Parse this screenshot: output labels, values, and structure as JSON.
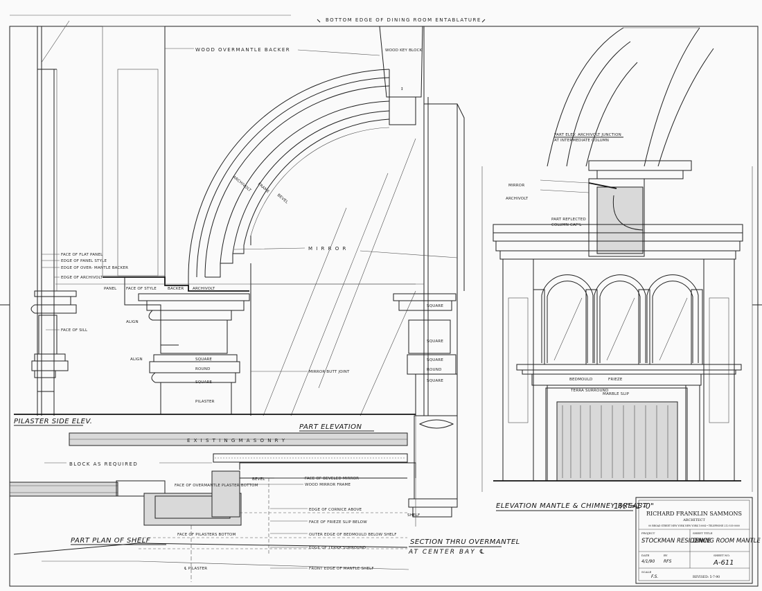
{
  "drawing": {
    "top_note": "BOTTOM EDGE OF DINING ROOM ENTABLATURE",
    "views": {
      "pilaster_side": "PILASTER SIDE ELEV.",
      "part_elevation": "PART ELEVATION",
      "part_plan": "PART PLAN OF SHELF",
      "section": "SECTION THRU OVERMANTEL",
      "section_sub": "AT CENTER BAY ℄",
      "elevation_mantle": "ELEVATION MANTLE & CHIMNEY BREAST",
      "elevation_scale": "1½\"=1'-0\"",
      "part_elev_archivolt": "PART ELEV. ARCHIVOLT JUNCTION",
      "part_elev_archivolt_sub": "AT INTERMEDIATE COLUMN",
      "part_reflected": "PART REFLECTED",
      "part_reflected_sub": "COLUMN CAP'L"
    },
    "labels": {
      "wood_overmantle_backer": "WOOD OVERMANTLE BACKER",
      "wood_key_block": "WOOD KEY BLOCK",
      "mirror": "M I R R O R",
      "archivolt": "ARCHIVOLT",
      "frame": "FRAME",
      "bevel": "BEVEL",
      "panel": "PANEL",
      "face_of_style": "FACE OF STYLE",
      "backer": "BACKER",
      "archivolt2": "ARCHIVOLT",
      "align": "ALIGN",
      "square": "SQUARE",
      "round": "ROUND",
      "pilaster": "PILASTER",
      "mirror_butt_joint": "MIRROR BUTT JOINT",
      "face_of_flat_panel": "FACE OF FLAT PANEL",
      "edge_of_panel_style": "EDGE OF PANEL STYLE",
      "edge_of_overmantle_backer": "EDGE OF OVER- MANTLE BACKER",
      "edge_of_archivolt": "EDGE OF ARCHIVOLT",
      "face_of_sill": "FACE OF SILL",
      "existing_masonry": "E X I S T I N G   M A S O N R Y",
      "block_as_required": "BLOCK AS REQUIRED",
      "bevel2": "BEVEL",
      "face_of_beveled_mirror": "FACE OF BEVELED MIRROR",
      "wood_mirror_frame": "WOOD MIRROR FRAME",
      "face_of_overmantle_plaster": "FACE OF OVERMANTLE PLASTER BOTTOM",
      "edge_of_cornice_above": "EDGE OF CORNICE ABOVE",
      "face_of_frieze_slip_below": "FACE OF FRIEZE SLIP BELOW",
      "face_of_pilasters_bottom": "FACE OF PILASTERS BOTTOM",
      "outer_edge_of_bedmould": "OUTER EDGE OF BEDMOULD BELOW SHELF",
      "edge_of_terra_surround": "EDGE OF TERRA SURROUND",
      "front_edge_of_mantle_shelf": "FRONT EDGE OF MANTLE SHELF",
      "pilaster_cl": "℄ PILASTER",
      "shelf": "SHELF",
      "mirror2": "MIRROR",
      "archivolt_label": "ARCHIVOLT",
      "bedmould": "BEDMOULD",
      "frieze": "FRIEZE",
      "terra_surround": "TERRA SURROUND",
      "marble_slip": "MARBLE SLIP"
    },
    "title_block": {
      "architect": "RICHARD FRANKLIN SAMMONS",
      "architect_role": "ARCHITECT",
      "address": "00 BROAD STREET NEW YORK NEW YORK 10004 • TELEPHONE 212-555-0000",
      "project_label": "PROJECT",
      "project": "STOCKMAN RESIDENCE",
      "sheet_title_label": "SHEET TITLE",
      "sheet_title": "DINING ROOM MANTLE",
      "date_label": "DATE",
      "date": "4/1/90",
      "by_label": "BY",
      "by": "RFS",
      "sheet_no_label": "SHEET NO.",
      "sheet_no": "A-611",
      "scale_label": "SCALE",
      "scale": "F.S.",
      "revised": "REVISED: 5-7-90"
    }
  }
}
